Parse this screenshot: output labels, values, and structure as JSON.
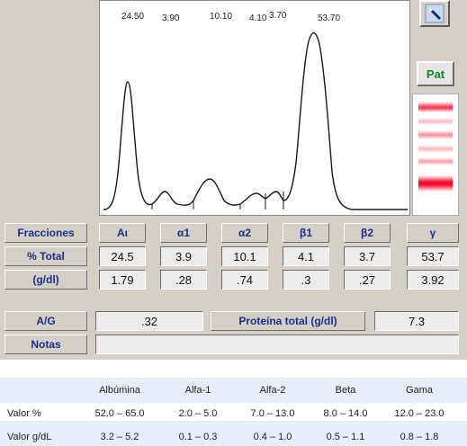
{
  "peak_labels": [
    "24.50",
    "3.90",
    "10.10",
    "4.10",
    "3.70",
    "53.70"
  ],
  "buttons": {
    "pat_label": "Pat"
  },
  "table": {
    "row_headers": [
      "Fracciones",
      "% Total",
      "(g/dl)"
    ],
    "fractions": [
      "Aι",
      "α1",
      "α2",
      "β1",
      "β2",
      "γ"
    ],
    "percent": [
      "24.5",
      "3.9",
      "10.1",
      "4.1",
      "3.7",
      "53.7"
    ],
    "gdl": [
      "1.79",
      ".28",
      ".74",
      ".3",
      ".27",
      "3.92"
    ]
  },
  "summary": {
    "ag_label": "A/G",
    "ag_value": ".32",
    "protein_label": "Proteína total (g/dl)",
    "protein_value": "7.3",
    "notes_label": "Notas",
    "notes_value": ""
  },
  "reference": {
    "columns": [
      "Albúmina",
      "Alfa-1",
      "Alfa-2",
      "Beta",
      "Gama"
    ],
    "rows": [
      {
        "label": "Valor %",
        "values": [
          "52.0 – 65.0",
          "2.0 – 5.0",
          "7.0 – 13.0",
          "8.0 – 14.0",
          "12.0 – 23.0"
        ]
      },
      {
        "label": "Valor g/dL",
        "values": [
          "3.2 – 5.2",
          "0.1 – 0.3",
          "0.4 – 1.0",
          "0.5 – 1.1",
          "0.8 – 1.8"
        ]
      }
    ]
  },
  "colors": {
    "panel_bg": "#d4d0c8",
    "header_text": "#1d2f8a",
    "pat_green": "#0a8a2a",
    "gel_red": "#e8002a",
    "reference_band": "#e8eef9"
  },
  "icons": {
    "top_tool": "magic-wand-icon"
  }
}
